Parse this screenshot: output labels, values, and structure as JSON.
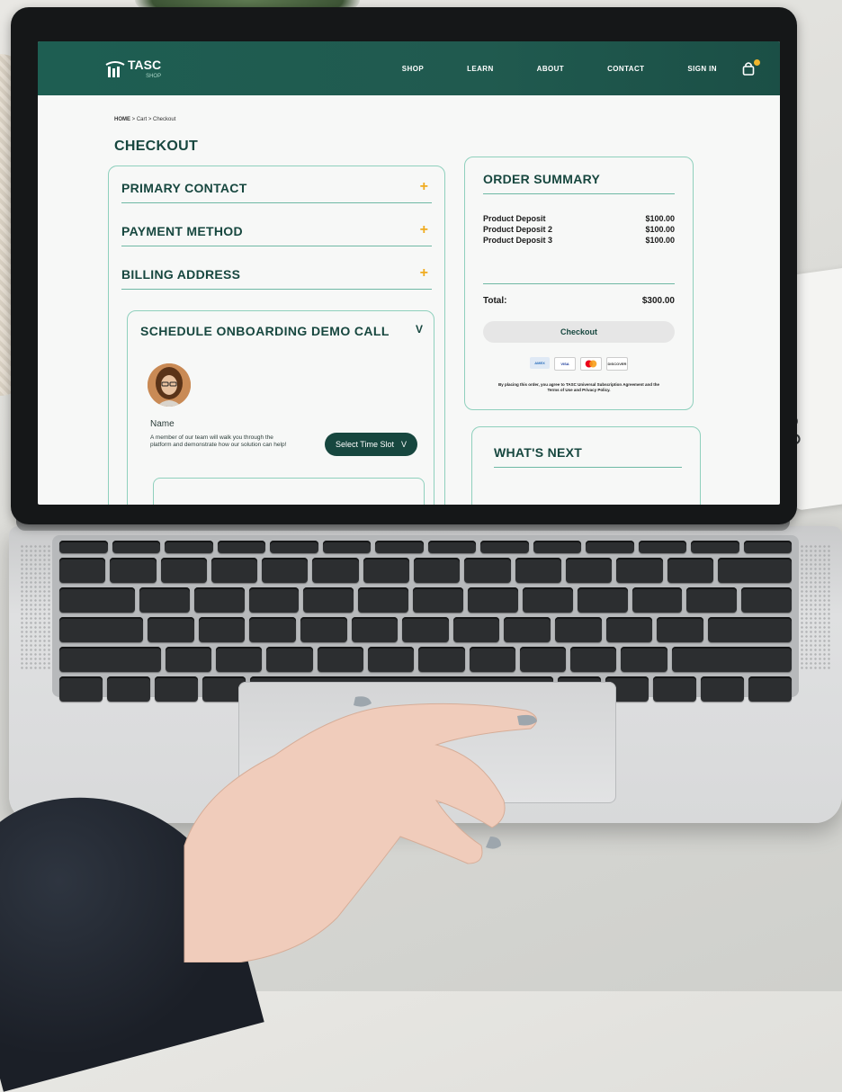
{
  "site": {
    "brand": "TASC",
    "brand_sub": "SHOP",
    "nav": [
      "SHOP",
      "LEARN",
      "ABOUT",
      "CONTACT",
      "SIGN IN"
    ]
  },
  "breadcrumb": {
    "home": "HOME",
    "rest": " > Cart > Checkout"
  },
  "page_title": "CHECKOUT",
  "sections": {
    "primary_contact": "PRIMARY CONTACT",
    "payment_method": "PAYMENT METHOD",
    "billing_address": "BILLING ADDRESS",
    "expand_icon": "+"
  },
  "onboarding": {
    "title": "SCHEDULE ONBOARDING DEMO CALL",
    "chevron": "V",
    "rep_name": "Name",
    "description": "A member of our team will walk you through the platform and demonstrate how our solution can help!",
    "button_label": "Select Time Slot",
    "button_chevron": "V"
  },
  "order_summary": {
    "title": "ORDER SUMMARY",
    "items": [
      {
        "name": "Product Deposit",
        "price": "$100.00"
      },
      {
        "name": "Product Deposit 2",
        "price": "$100.00"
      },
      {
        "name": "Product Deposit 3",
        "price": "$100.00"
      }
    ],
    "total_label": "Total:",
    "total_value": "$300.00",
    "checkout_label": "Checkout",
    "payment_cards": [
      "AMEX",
      "VISA",
      "mastercard",
      "DISCOVER"
    ],
    "legal": "By placing this order, you agree to TASC Universal Subscription Agreement and the Terms of Use and Privacy Policy."
  },
  "whats_next": {
    "title": "WHAT'S NEXT"
  },
  "colors": {
    "header": "#1e5e52",
    "heading": "#17473f",
    "accent": "#f0ab1f",
    "border": "#8fd0bd"
  }
}
